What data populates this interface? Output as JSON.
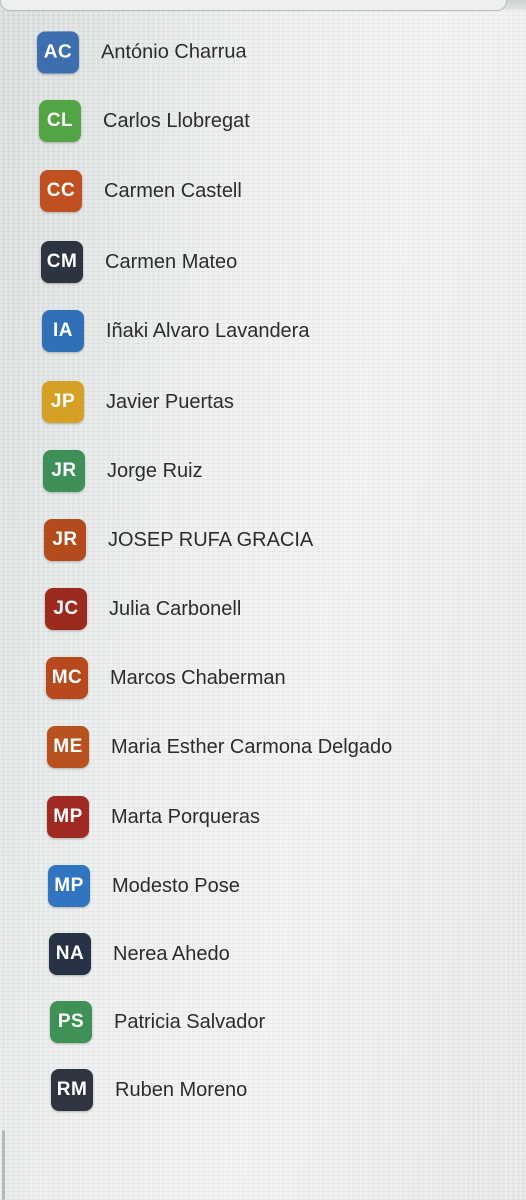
{
  "contacts": [
    {
      "initials": "AC",
      "name": "António Charrua",
      "color": "#3d6fae"
    },
    {
      "initials": "CL",
      "name": "Carlos Llobregat",
      "color": "#53a445"
    },
    {
      "initials": "CC",
      "name": "Carmen Castell",
      "color": "#c0501f"
    },
    {
      "initials": "CM",
      "name": "Carmen Mateo",
      "color": "#2c3440"
    },
    {
      "initials": "IA",
      "name": "Iñaki Alvaro Lavandera",
      "color": "#2f70b6"
    },
    {
      "initials": "JP",
      "name": "Javier Puertas",
      "color": "#d6a024"
    },
    {
      "initials": "JR",
      "name": "Jorge Ruiz",
      "color": "#3f8f58"
    },
    {
      "initials": "JR",
      "name": "JOSEP RUFA GRACIA",
      "color": "#b44b1c"
    },
    {
      "initials": "JC",
      "name": "Julia Carbonell",
      "color": "#9c2a1f"
    },
    {
      "initials": "MC",
      "name": "Marcos Chaberman",
      "color": "#b7491c"
    },
    {
      "initials": "ME",
      "name": "Maria Esther Carmona Delgado",
      "color": "#b8511e"
    },
    {
      "initials": "MP",
      "name": "Marta Porqueras",
      "color": "#a02a22"
    },
    {
      "initials": "MP",
      "name": "Modesto Pose",
      "color": "#3174bf"
    },
    {
      "initials": "NA",
      "name": "Nerea Ahedo",
      "color": "#273244"
    },
    {
      "initials": "PS",
      "name": "Patricia Salvador",
      "color": "#3f9156"
    },
    {
      "initials": "RM",
      "name": "Ruben Moreno",
      "color": "#2e3540"
    }
  ]
}
